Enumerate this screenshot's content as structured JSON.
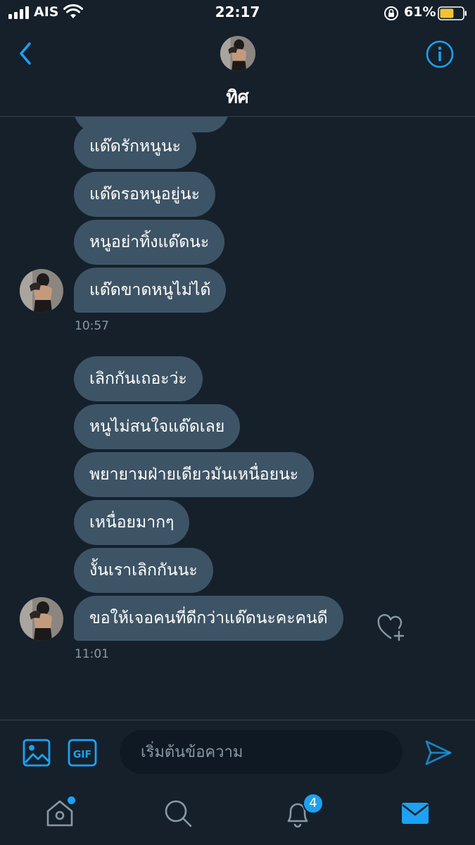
{
  "status_bar": {
    "carrier": "AIS",
    "time": "22:17",
    "battery_percent": "61%",
    "battery_level": 0.61,
    "signal_bars": 4
  },
  "header": {
    "contact_name": "ทิศ",
    "back_icon": "chevron-left-icon",
    "info_icon": "info-icon"
  },
  "conversation": {
    "groups": [
      {
        "messages": [
          "แด๊ดรักหนูนะ",
          "แด๊ดรอหนูอยู่นะ",
          "หนูอย่าทิ้งแด๊ดนะ",
          "แด๊ดขาดหนูไม่ได้"
        ],
        "time": "10:57"
      },
      {
        "messages": [
          "เลิกกันเถอะว่ะ",
          "หนูไม่สนใจแด๊ดเลย",
          "พยายามฝ่ายเดียวมันเหนื่อยนะ",
          "เหนื่อยมากๆ",
          "งั้นเราเลิกกันนะ",
          "ขอให้เจอคนที่ดีกว่าแด๊ดนะคะคนดี"
        ],
        "time": "11:01"
      }
    ]
  },
  "composer": {
    "placeholder": "เริ่มต้นข้อความ",
    "gif_label": "GIF"
  },
  "tab_bar": {
    "notification_count": "4"
  },
  "colors": {
    "background": "#15202b",
    "bubble": "#3d5466",
    "accent": "#1da1f2",
    "muted": "#8899a6"
  }
}
